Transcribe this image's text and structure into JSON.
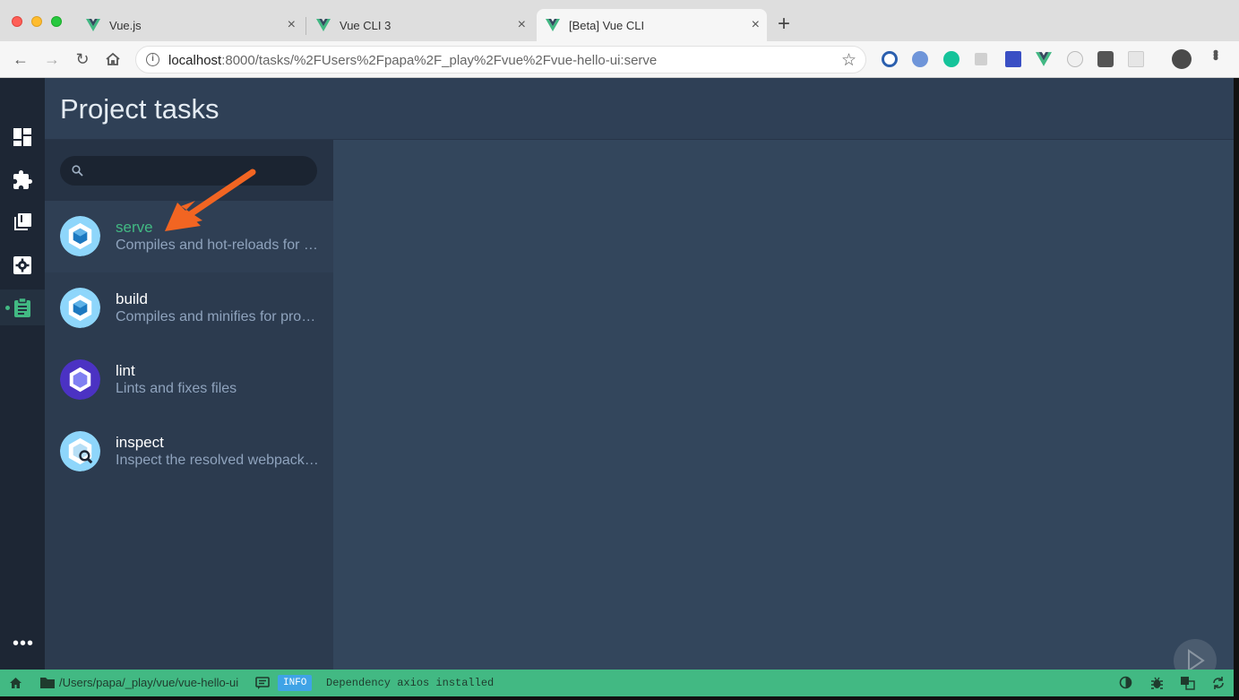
{
  "browser": {
    "tabs": [
      {
        "title": "Vue.js"
      },
      {
        "title": "Vue CLI 3"
      },
      {
        "title": "[Beta] Vue CLI"
      }
    ],
    "url_host": "localhost",
    "url_rest": ":8000/tasks/%2FUsers%2Fpapa%2F_play%2Fvue%2Fvue-hello-ui:serve"
  },
  "header": {
    "title": "Project tasks"
  },
  "search": {
    "placeholder": ""
  },
  "tasks": [
    {
      "name": "serve",
      "description": "Compiles and hot-reloads for development",
      "icon": "webpack-cube-icon",
      "selected": true
    },
    {
      "name": "build",
      "description": "Compiles and minifies for production",
      "icon": "webpack-cube-icon",
      "selected": false
    },
    {
      "name": "lint",
      "description": "Lints and fixes files",
      "icon": "eslint-hexagon-icon",
      "selected": false
    },
    {
      "name": "inspect",
      "description": "Inspect the resolved webpack config",
      "icon": "webpack-inspect-icon",
      "selected": false
    }
  ],
  "statusbar": {
    "path": "/Users/papa/_play/vue/vue-hello-ui",
    "badge": "INFO",
    "message": "Dependency axios installed"
  },
  "colors": {
    "accent": "#42b983",
    "info_badge": "#3fa3e6",
    "arrow_annotation": "#f26522"
  }
}
